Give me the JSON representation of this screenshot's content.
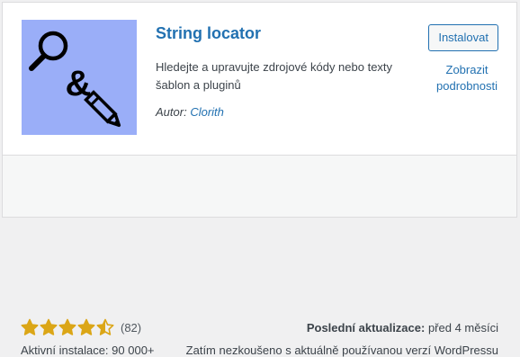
{
  "plugin": {
    "name": "String locator",
    "description": "Hledejte a upravujte zdrojové kódy nebo texty šablon a pluginů",
    "author_label": "Autor:",
    "author_name": "Clorith",
    "icon_glyph": "&",
    "icon_color": "#9aaef8"
  },
  "actions": {
    "install_label": "Instalovat",
    "details_label": "Zobrazit podrobnosti"
  },
  "stats": {
    "rating": 4.5,
    "rating_max": 5,
    "rating_count": "(82)",
    "installs": "Aktivní instalace: 90 000+",
    "last_updated_label": "Poslední aktualizace:",
    "last_updated_value": "před 4 měsíci",
    "compatibility": "Zatím nezkoušeno s aktuálně používanou verzí WordPressu"
  },
  "colors": {
    "link": "#2271b1",
    "star": "#dba617"
  }
}
